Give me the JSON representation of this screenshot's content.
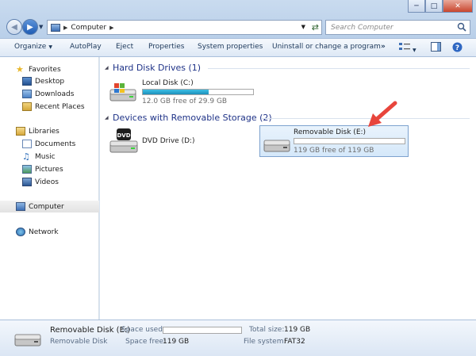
{
  "window": {
    "minimize_icon": "minimize-icon",
    "maximize_icon": "maximize-icon",
    "close_icon": "close-icon"
  },
  "address": {
    "path": "Computer",
    "icon": "computer-icon"
  },
  "search": {
    "placeholder": "Search Computer"
  },
  "toolbar": {
    "organize": "Organize",
    "autoplay": "AutoPlay",
    "eject": "Eject",
    "properties": "Properties",
    "system_properties": "System properties",
    "uninstall": "Uninstall or change a program",
    "more": "»"
  },
  "sidebar": {
    "favorites": "Favorites",
    "desktop": "Desktop",
    "downloads": "Downloads",
    "recent_places": "Recent Places",
    "libraries": "Libraries",
    "documents": "Documents",
    "music": "Music",
    "pictures": "Pictures",
    "videos": "Videos",
    "computer": "Computer",
    "network": "Network"
  },
  "main": {
    "hdd_group": "Hard Disk Drives (1)",
    "removable_group": "Devices with Removable Storage (2)",
    "local_disk": {
      "name": "Local Disk (C:)",
      "free": "12.0 GB free of 29.9 GB",
      "used_fraction": 0.6
    },
    "dvd": {
      "name": "DVD Drive (D:)",
      "label": "DVD"
    },
    "removable": {
      "name": "Removable Disk (E:)",
      "free": "119 GB free of 119 GB",
      "used_fraction": 0.0
    }
  },
  "status": {
    "name": "Removable Disk (E:)",
    "type": "Removable Disk",
    "space_used_label": "Space used:",
    "space_free_label": "Space free:",
    "space_free_value": "119 GB",
    "total_size_label": "Total size:",
    "total_size_value": "119 GB",
    "file_system_label": "File system:",
    "file_system_value": "FAT32"
  },
  "colors": {
    "annotation_arrow": "#e8453c",
    "selection": "#d5e8fa",
    "group_header": "#1e3287"
  }
}
